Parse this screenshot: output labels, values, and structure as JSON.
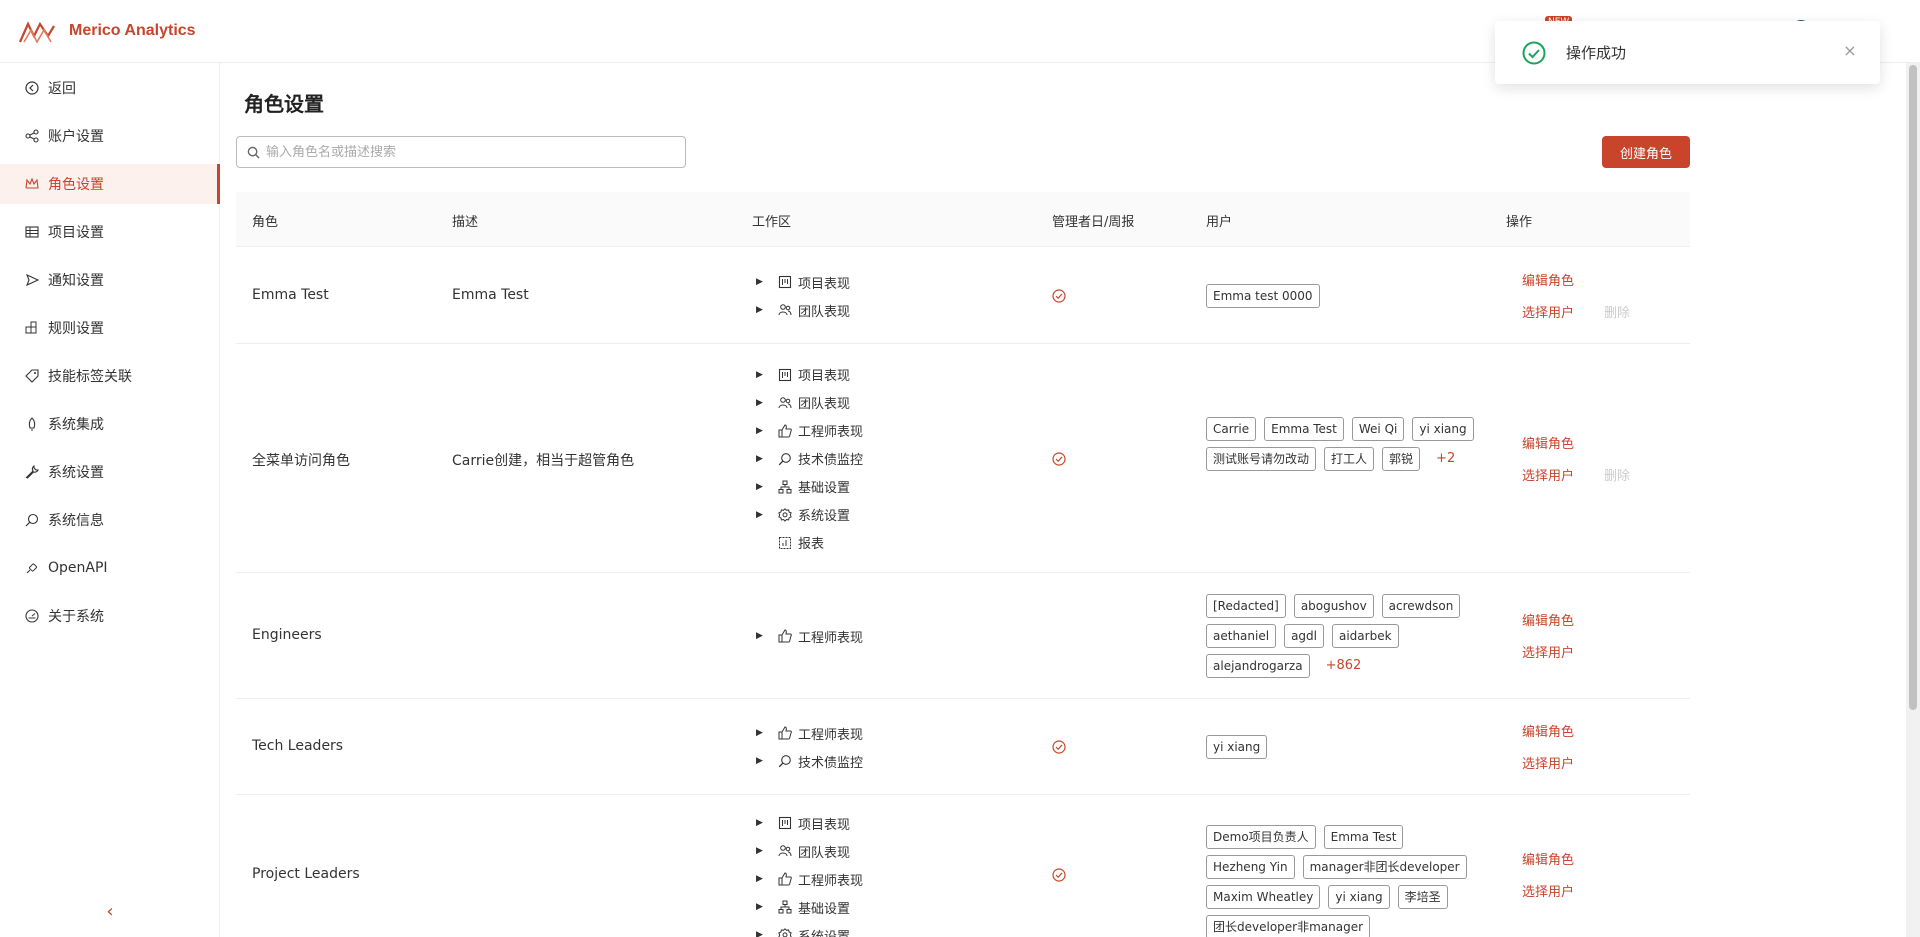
{
  "app": {
    "name": "Merico Analytics",
    "badge": "NEW"
  },
  "sidebar": {
    "items": [
      {
        "label": "返回",
        "icon": "back-circle-icon"
      },
      {
        "label": "账户设置",
        "icon": "share-nodes-icon"
      },
      {
        "label": "角色设置",
        "icon": "crown-icon",
        "active": true
      },
      {
        "label": "项目设置",
        "icon": "table-grid-icon"
      },
      {
        "label": "通知设置",
        "icon": "send-icon"
      },
      {
        "label": "规则设置",
        "icon": "rule-blocks-icon"
      },
      {
        "label": "技能标签关联",
        "icon": "tag-icon"
      },
      {
        "label": "系统集成",
        "icon": "rocket-icon"
      },
      {
        "label": "系统设置",
        "icon": "wrench-icon"
      },
      {
        "label": "系统信息",
        "icon": "zoom-chart-icon"
      },
      {
        "label": "OpenAPI",
        "icon": "plug-icon"
      },
      {
        "label": "关于系统",
        "icon": "gauge-icon"
      }
    ],
    "collapse": "‹"
  },
  "page": {
    "title": "角色设置",
    "search_placeholder": "输入角色名或描述搜索",
    "create_label": "创建角色"
  },
  "table": {
    "headers": [
      "角色",
      "描述",
      "工作区",
      "管理者日/周报",
      "用户",
      "操作"
    ],
    "rows": [
      {
        "role": "Emma Test",
        "desc": "Emma Test",
        "workspaces": [
          {
            "label": "项目表现",
            "icon": "project-board-icon",
            "expandable": true
          },
          {
            "label": "团队表现",
            "icon": "team-icon",
            "expandable": true
          }
        ],
        "manager_report": true,
        "users": [
          "Emma test 0000"
        ],
        "more": "",
        "ops": {
          "edit": "编辑角色",
          "select": "选择用户",
          "delete": "删除"
        }
      },
      {
        "role": "全菜单访问角色",
        "desc": "Carrie创建，相当于超管角色",
        "workspaces": [
          {
            "label": "项目表现",
            "icon": "project-board-icon",
            "expandable": true
          },
          {
            "label": "团队表现",
            "icon": "team-icon",
            "expandable": true
          },
          {
            "label": "工程师表现",
            "icon": "thumbs-up-icon",
            "expandable": true
          },
          {
            "label": "技术债监控",
            "icon": "magnifier-icon",
            "expandable": true
          },
          {
            "label": "基础设置",
            "icon": "hierarchy-icon",
            "expandable": true
          },
          {
            "label": "系统设置",
            "icon": "gear-icon",
            "expandable": true
          },
          {
            "label": "报表",
            "icon": "report-icon",
            "expandable": false
          }
        ],
        "manager_report": true,
        "users": [
          "Carrie",
          "Emma Test",
          "Wei Qi",
          "yi xiang",
          "测试账号请勿改动",
          "打工人",
          "郭锐"
        ],
        "more": "+2",
        "ops": {
          "edit": "编辑角色",
          "select": "选择用户",
          "delete": "删除"
        }
      },
      {
        "role": "Engineers",
        "desc": "",
        "workspaces": [
          {
            "label": "工程师表现",
            "icon": "thumbs-up-icon",
            "expandable": true
          }
        ],
        "manager_report": false,
        "users": [
          "[Redacted]",
          "abogushov",
          "acrewdson",
          "aethaniel",
          "agdl",
          "aidarbek",
          "alejandrogarza"
        ],
        "more": "+862",
        "ops": {
          "edit": "编辑角色",
          "select": "选择用户",
          "delete": ""
        }
      },
      {
        "role": "Tech Leaders",
        "desc": "",
        "workspaces": [
          {
            "label": "工程师表现",
            "icon": "thumbs-up-icon",
            "expandable": true
          },
          {
            "label": "技术债监控",
            "icon": "magnifier-icon",
            "expandable": true
          }
        ],
        "manager_report": true,
        "users": [
          "yi xiang"
        ],
        "more": "",
        "ops": {
          "edit": "编辑角色",
          "select": "选择用户",
          "delete": ""
        }
      },
      {
        "role": "Project Leaders",
        "desc": "",
        "workspaces": [
          {
            "label": "项目表现",
            "icon": "project-board-icon",
            "expandable": true
          },
          {
            "label": "团队表现",
            "icon": "team-icon",
            "expandable": true
          },
          {
            "label": "工程师表现",
            "icon": "thumbs-up-icon",
            "expandable": true
          },
          {
            "label": "基础设置",
            "icon": "hierarchy-icon",
            "expandable": true
          },
          {
            "label": "系统设置",
            "icon": "gear-icon",
            "expandable": true
          }
        ],
        "manager_report": true,
        "users": [
          "Demo项目负责人",
          "Emma Test",
          "Hezheng Yin",
          "manager非团长developer",
          "Maxim Wheatley",
          "yi xiang",
          "李培圣",
          "团长developer非manager"
        ],
        "more": "",
        "ops": {
          "edit": "编辑角色",
          "select": "选择用户",
          "delete": ""
        }
      }
    ]
  },
  "toast": {
    "message": "操作成功",
    "close": "×"
  },
  "colors": {
    "accent": "#c8442a",
    "success": "#1aa35b"
  }
}
